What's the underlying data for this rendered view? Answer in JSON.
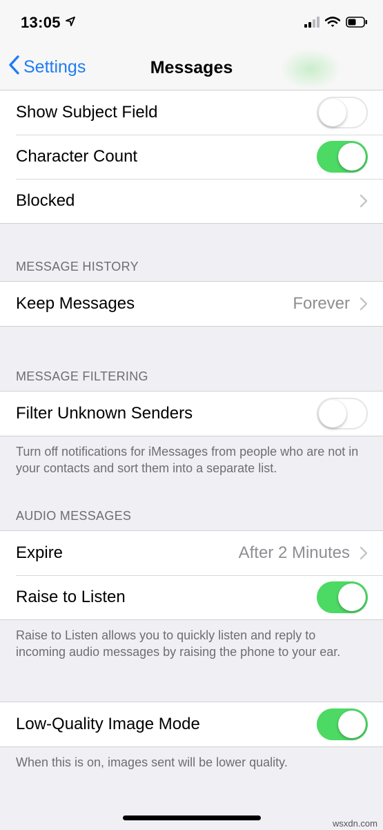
{
  "status_bar": {
    "time": "13:05"
  },
  "nav": {
    "back_label": "Settings",
    "title": "Messages"
  },
  "top_group": {
    "show_subject_field": {
      "label": "Show Subject Field",
      "enabled": false
    },
    "character_count": {
      "label": "Character Count",
      "enabled": true
    },
    "blocked": {
      "label": "Blocked"
    }
  },
  "message_history": {
    "header": "MESSAGE HISTORY",
    "keep_messages": {
      "label": "Keep Messages",
      "value": "Forever"
    }
  },
  "message_filtering": {
    "header": "MESSAGE FILTERING",
    "filter_unknown_senders": {
      "label": "Filter Unknown Senders",
      "enabled": false
    },
    "footer": "Turn off notifications for iMessages from people who are not in your contacts and sort them into a separate list."
  },
  "audio_messages": {
    "header": "AUDIO MESSAGES",
    "expire": {
      "label": "Expire",
      "value": "After 2 Minutes"
    },
    "raise_to_listen": {
      "label": "Raise to Listen",
      "enabled": true
    },
    "footer": "Raise to Listen allows you to quickly listen and reply to incoming audio messages by raising the phone to your ear."
  },
  "low_quality": {
    "label": "Low-Quality Image Mode",
    "enabled": true,
    "footer": "When this is on, images sent will be lower quality."
  },
  "watermark": "wsxdn.com",
  "colors": {
    "accent": "#1d7cf5",
    "toggle_on": "#4cd964",
    "background": "#efeff4"
  }
}
